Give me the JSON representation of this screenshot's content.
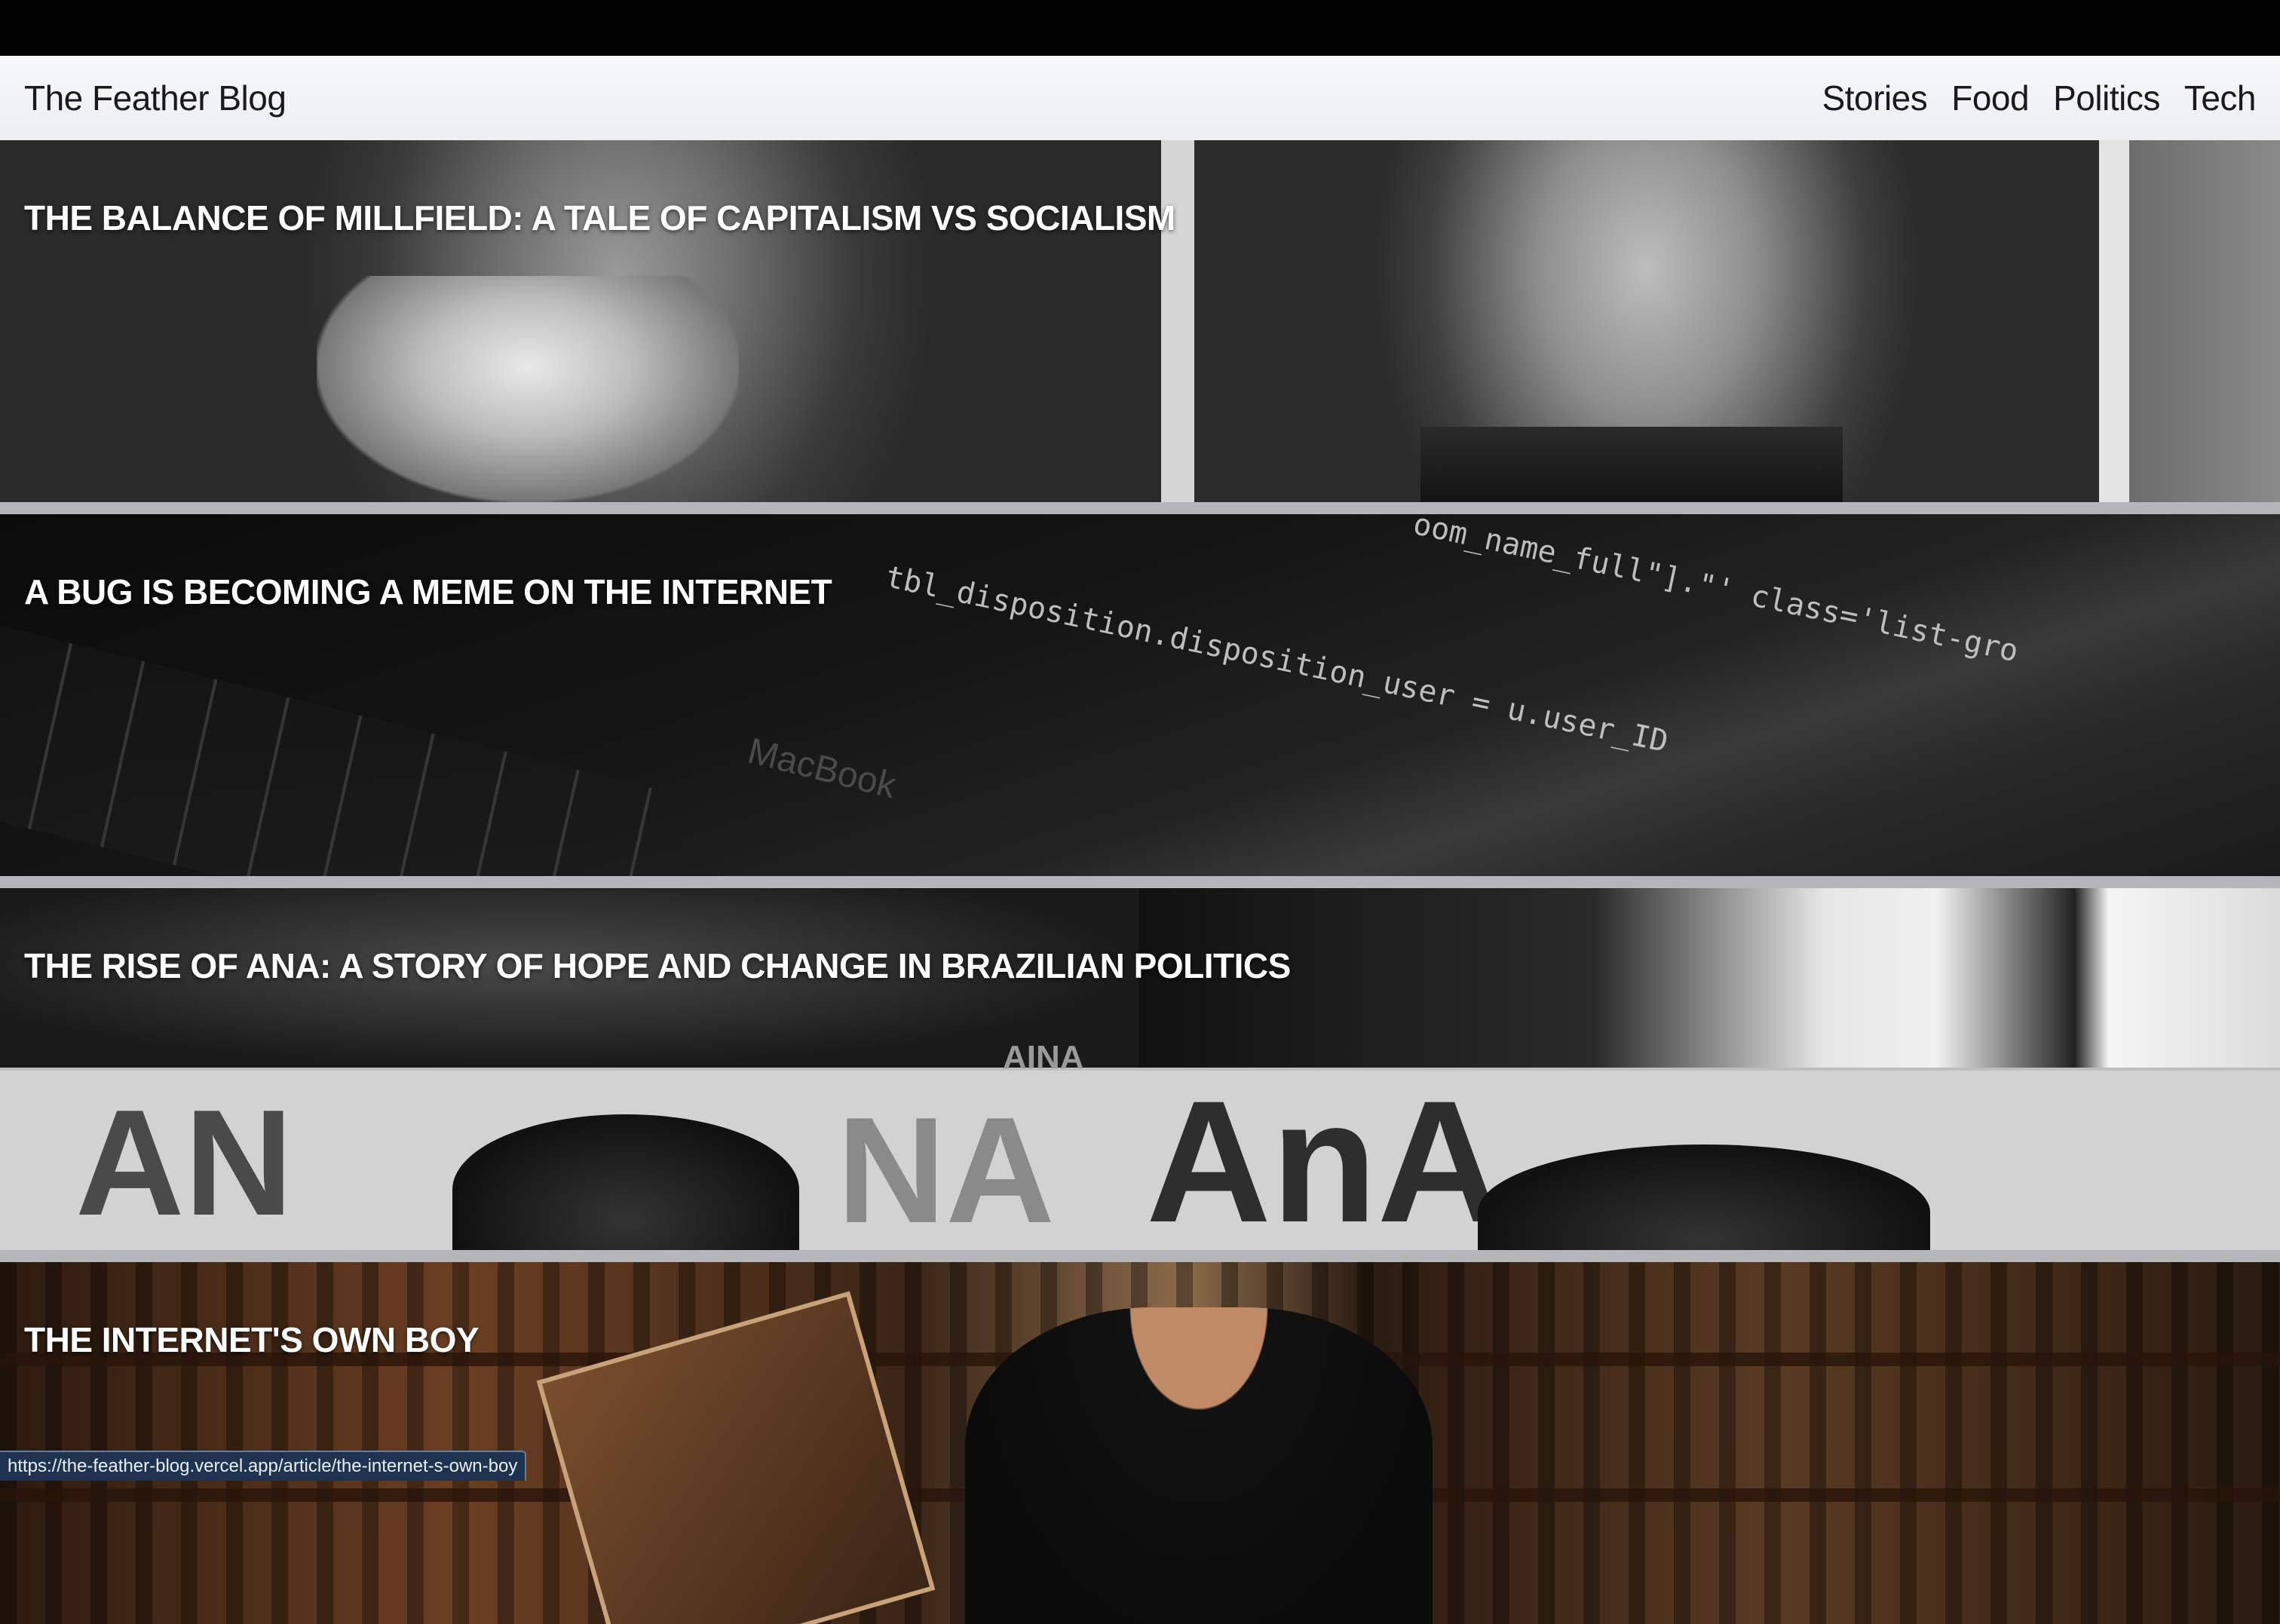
{
  "header": {
    "brand": "The Feather Blog",
    "nav": [
      "Stories",
      "Food",
      "Politics",
      "Tech"
    ]
  },
  "articles": [
    {
      "title": "THE BALANCE OF MILLFIELD: A TALE OF CAPITALISM VS SOCIALISM"
    },
    {
      "title": "A BUG IS BECOMING A MEME ON THE INTERNET"
    },
    {
      "title": "THE RISE OF ANA: A STORY OF HOPE AND CHANGE IN BRAZILIAN POLITICS"
    },
    {
      "title": "THE INTERNET'S OWN BOY"
    }
  ],
  "images": {
    "code_lines": [
      "oom_name_full\"].\"' class='list-gro",
      "tbl_disposition.disposition_user = u.user_ID"
    ],
    "laptop_brand": "MacBook",
    "poster_texts": [
      "AINA",
      "AN",
      "NA",
      "AnA"
    ]
  },
  "status_bar": {
    "url": "https://the-feather-blog.vercel.app/article/the-internet-s-own-boy"
  },
  "colors": {
    "navbar_bg": "#f3f4f6",
    "divider": "#b4b6ba",
    "status_bg": "#1f3350"
  }
}
